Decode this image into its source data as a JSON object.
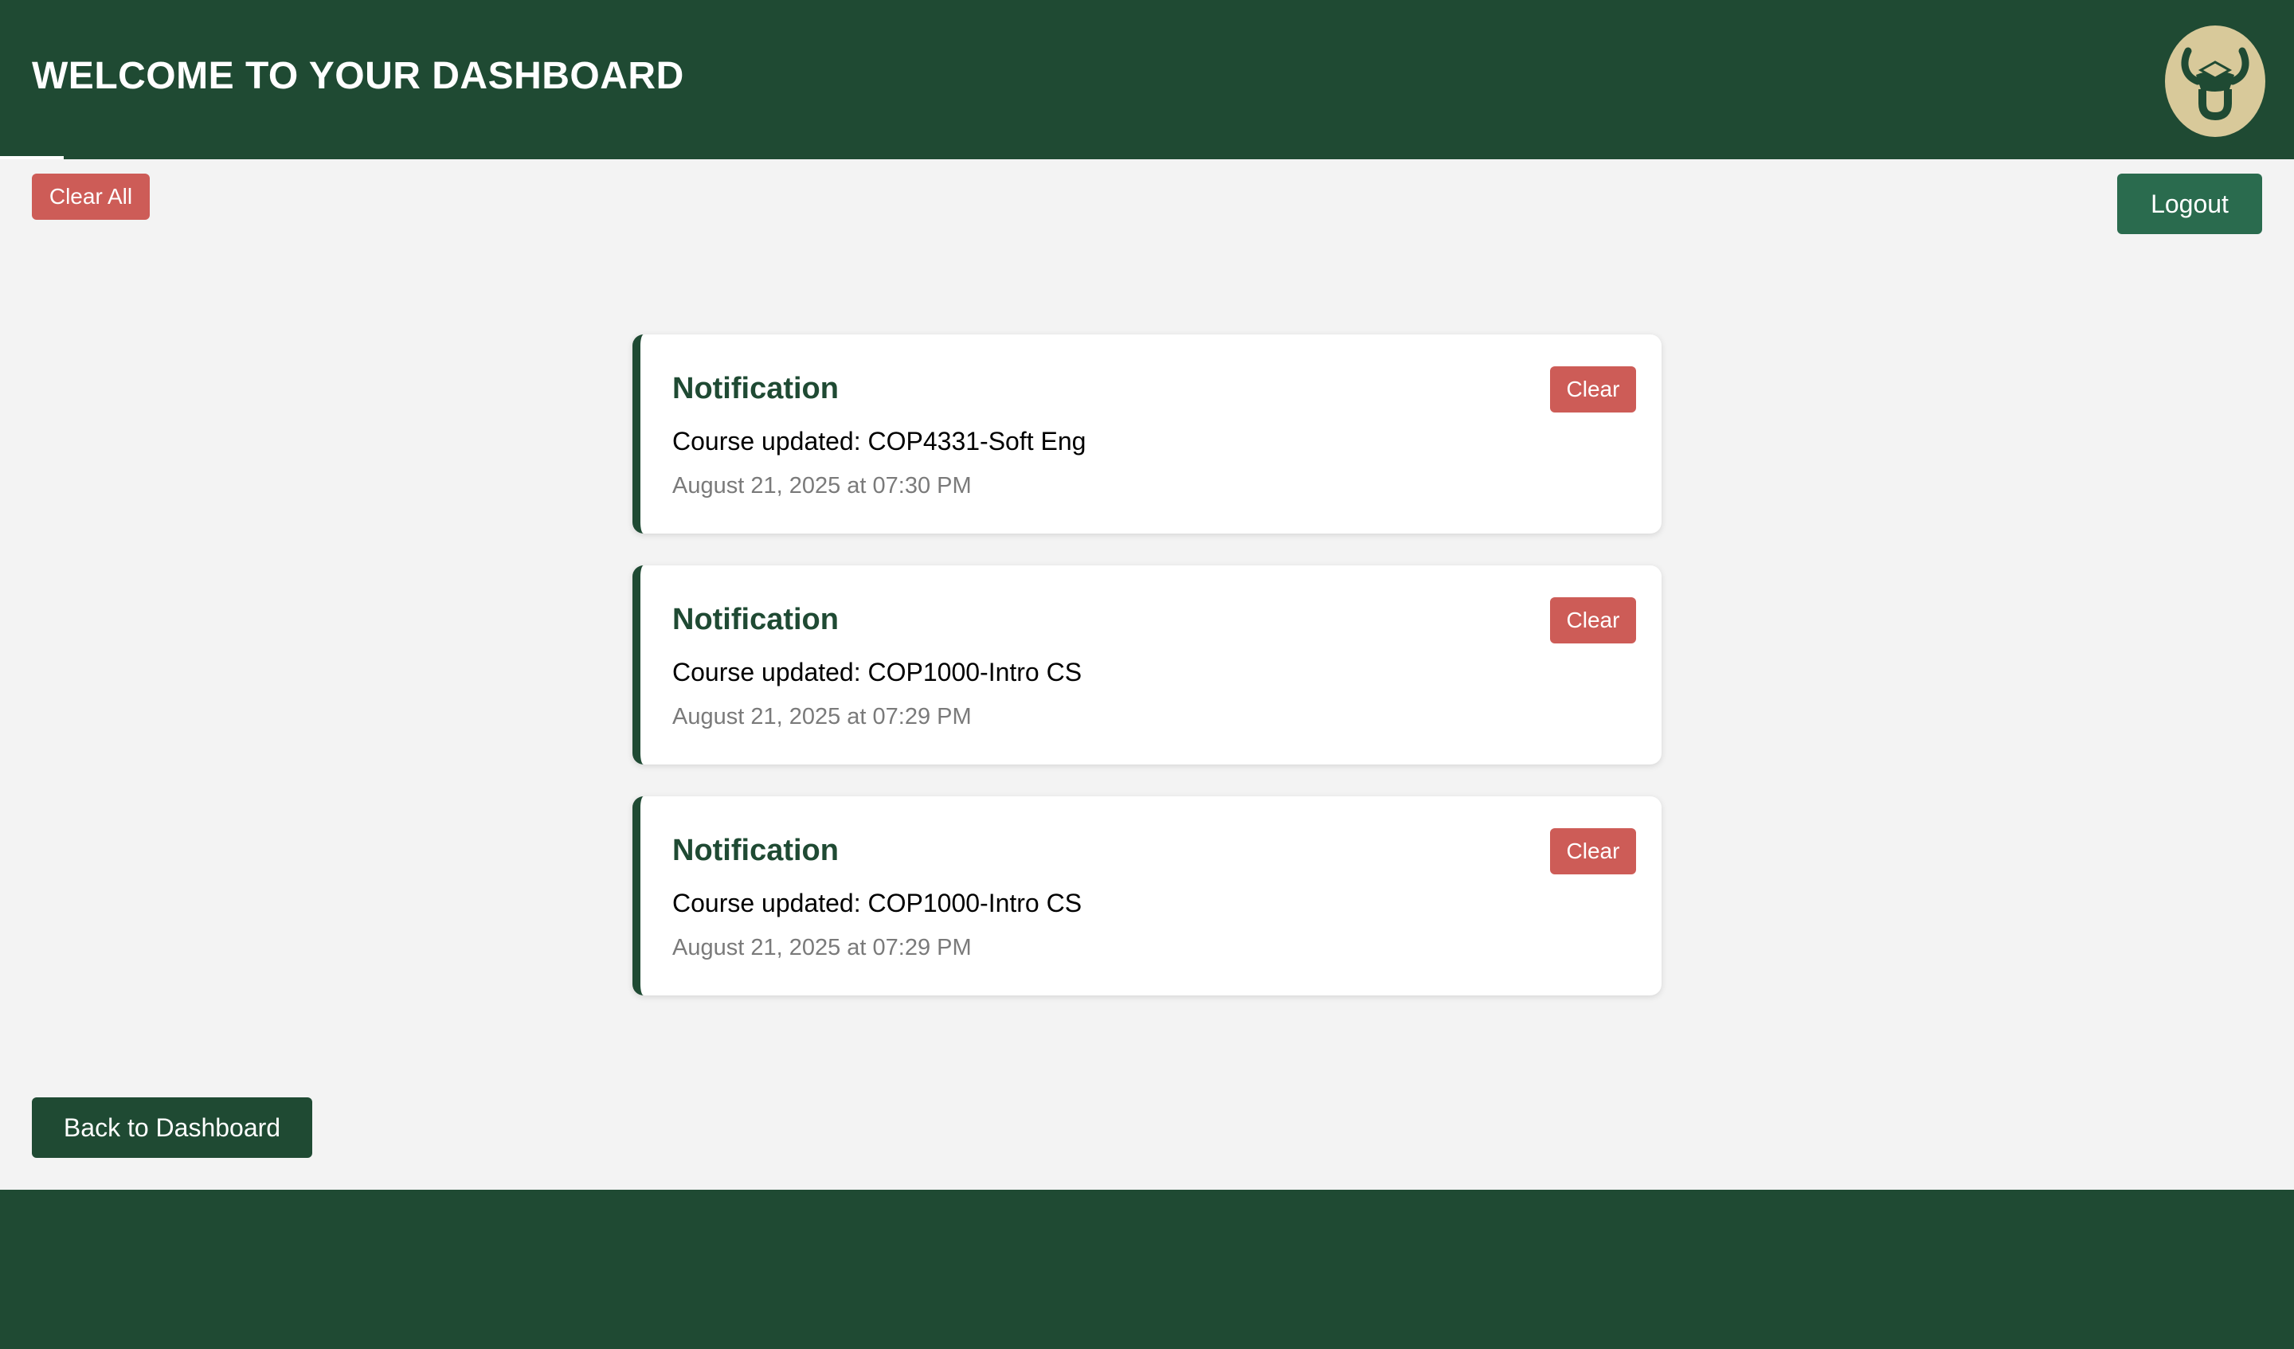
{
  "header": {
    "title": "WELCOME TO YOUR DASHBOARD",
    "avatar_icon": "bull-logo-icon",
    "background_color": "#1f4a33"
  },
  "toolbar": {
    "clear_all_label": "Clear All",
    "logout_label": "Logout"
  },
  "notifications": [
    {
      "title": "Notification",
      "message": "Course updated: COP4331-Soft Eng",
      "time": "August 21, 2025 at 07:30 PM",
      "clear_label": "Clear"
    },
    {
      "title": "Notification",
      "message": "Course updated: COP1000-Intro CS",
      "time": "August 21, 2025 at 07:29 PM",
      "clear_label": "Clear"
    },
    {
      "title": "Notification",
      "message": "Course updated: COP1000-Intro CS",
      "time": "August 21, 2025 at 07:29 PM",
      "clear_label": "Clear"
    }
  ],
  "footer_nav": {
    "back_label": "Back to Dashboard"
  },
  "colors": {
    "brand_green": "#1f4a33",
    "logout_green": "#2a6b4e",
    "danger_red": "#cd5c57",
    "avatar_gold": "#d8c99a"
  }
}
